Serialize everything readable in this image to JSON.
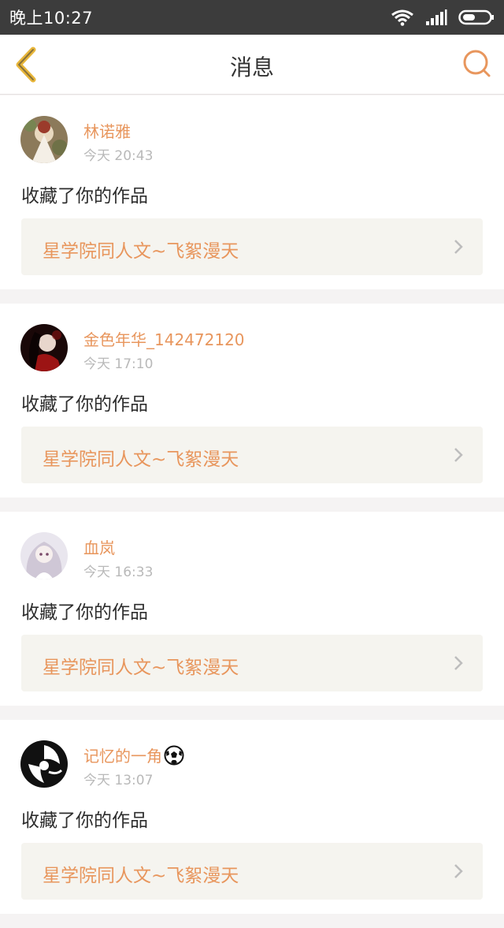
{
  "status_bar": {
    "time": "晚上10:27"
  },
  "nav": {
    "title": "消息"
  },
  "colors": {
    "accent": "#e8965d",
    "back_arrow": "#e8b63a",
    "status_bar_bg": "#3c3c3c"
  },
  "messages": [
    {
      "user": "林诺雅",
      "time": "今天 20:43",
      "action": "收藏了你的作品",
      "work": "星学院同人文~飞絮漫天"
    },
    {
      "user": "金色年华_142472120",
      "time": "今天 17:10",
      "action": "收藏了你的作品",
      "work": "星学院同人文~飞絮漫天"
    },
    {
      "user": "血岚",
      "time": "今天 16:33",
      "action": "收藏了你的作品",
      "work": "星学院同人文~飞絮漫天"
    },
    {
      "user": "记忆的一角",
      "time": "今天 13:07",
      "action": "收藏了你的作品",
      "work": "星学院同人文~飞絮漫天"
    }
  ]
}
